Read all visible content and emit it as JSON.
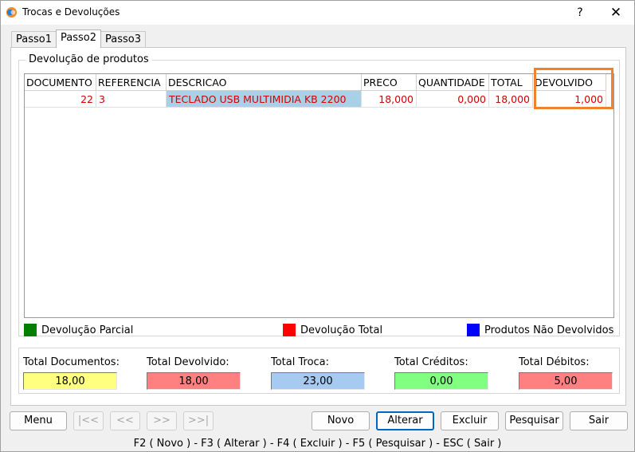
{
  "window": {
    "title": "Trocas e Devoluções",
    "help_glyph": "?",
    "close_glyph": "✕"
  },
  "tabs": [
    {
      "label": "Passo1",
      "active": false
    },
    {
      "label": "Passo2",
      "active": true
    },
    {
      "label": "Passo3",
      "active": false
    }
  ],
  "group": {
    "title": "Devolução de produtos"
  },
  "table": {
    "columns": [
      "DOCUMENTO",
      "REFERENCIA",
      "DESCRICAO",
      "PRECO",
      "QUANTIDADE",
      "TOTAL",
      "DEVOLVIDO"
    ],
    "rows": [
      {
        "documento": "22",
        "referencia": "3",
        "descricao": "TECLADO USB MULTIMIDIA KB 2200",
        "preco": "18,000",
        "quantidade": "0,000",
        "total": "18,000",
        "devolvido": "1,000"
      }
    ]
  },
  "legend": [
    {
      "label": "Devolução Parcial",
      "color": "#008000"
    },
    {
      "label": "Devolução Total",
      "color": "#ff0000"
    },
    {
      "label": "Produtos Não Devolvidos",
      "color": "#0000ff"
    }
  ],
  "totals": [
    {
      "label": "Total Documentos:",
      "value": "18,00",
      "color": "#ffff80"
    },
    {
      "label": "Total Devolvido:",
      "value": "18,00",
      "color": "#ff8080"
    },
    {
      "label": "Total Troca:",
      "value": "23,00",
      "color": "#a6caf0"
    },
    {
      "label": "Total Créditos:",
      "value": "0,00",
      "color": "#80ff80"
    },
    {
      "label": "Total Débitos:",
      "value": "5,00",
      "color": "#ff8080"
    }
  ],
  "buttons": {
    "menu": "Menu",
    "first": "|<<",
    "prev": "<<",
    "next": ">>",
    "last": ">>|",
    "novo": "Novo",
    "alterar": "Alterar",
    "excluir": "Excluir",
    "pesquisar": "Pesquisar",
    "sair": "Sair"
  },
  "status": {
    "shortcuts": "F2 ( Novo )  -  F3 ( Alterar )  -  F4 ( Excluir )  -  F5 ( Pesquisar )  -  ESC ( Sair )"
  },
  "colors": {
    "highlight": "#f0822d",
    "row_text": "#d40000",
    "selected_cell": "#a8d0e6"
  }
}
